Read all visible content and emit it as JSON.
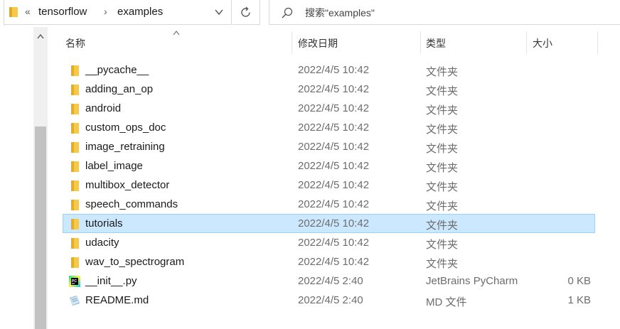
{
  "address": {
    "overflow": "«",
    "crumbs": [
      "tensorflow",
      "examples"
    ]
  },
  "search": {
    "placeholder": "搜索\"examples\""
  },
  "columns": {
    "name": "名称",
    "date": "修改日期",
    "type": "类型",
    "size": "大小"
  },
  "files": [
    {
      "name": "__pycache__",
      "date": "2022/4/5 10:42",
      "type": "文件夹",
      "size": "",
      "icon": "folder-icon"
    },
    {
      "name": "adding_an_op",
      "date": "2022/4/5 10:42",
      "type": "文件夹",
      "size": "",
      "icon": "folder-icon"
    },
    {
      "name": "android",
      "date": "2022/4/5 10:42",
      "type": "文件夹",
      "size": "",
      "icon": "folder-icon"
    },
    {
      "name": "custom_ops_doc",
      "date": "2022/4/5 10:42",
      "type": "文件夹",
      "size": "",
      "icon": "folder-icon"
    },
    {
      "name": "image_retraining",
      "date": "2022/4/5 10:42",
      "type": "文件夹",
      "size": "",
      "icon": "folder-icon"
    },
    {
      "name": "label_image",
      "date": "2022/4/5 10:42",
      "type": "文件夹",
      "size": "",
      "icon": "folder-icon"
    },
    {
      "name": "multibox_detector",
      "date": "2022/4/5 10:42",
      "type": "文件夹",
      "size": "",
      "icon": "folder-icon"
    },
    {
      "name": "speech_commands",
      "date": "2022/4/5 10:42",
      "type": "文件夹",
      "size": "",
      "icon": "folder-icon"
    },
    {
      "name": "tutorials",
      "date": "2022/4/5 10:42",
      "type": "文件夹",
      "size": "",
      "icon": "folder-icon",
      "selected": true
    },
    {
      "name": "udacity",
      "date": "2022/4/5 10:42",
      "type": "文件夹",
      "size": "",
      "icon": "folder-icon"
    },
    {
      "name": "wav_to_spectrogram",
      "date": "2022/4/5 10:42",
      "type": "文件夹",
      "size": "",
      "icon": "folder-icon"
    },
    {
      "name": "__init__.py",
      "date": "2022/4/5 2:40",
      "type": "JetBrains PyCharm",
      "size": "0 KB",
      "icon": "pycharm-file-icon"
    },
    {
      "name": "README.md",
      "date": "2022/4/5 2:40",
      "type": "MD 文件",
      "size": "1 KB",
      "icon": "md-file-icon"
    }
  ],
  "colors": {
    "selection_bg": "#cce8ff",
    "selection_border": "#99d1ff",
    "folder": "#f7c948",
    "secondary_text": "#6d6d6d"
  }
}
